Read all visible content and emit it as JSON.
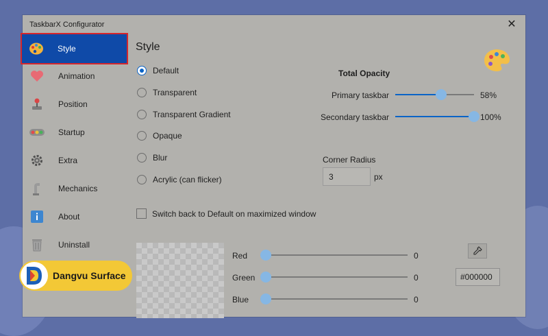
{
  "window": {
    "title": "TaskbarX Configurator",
    "close_glyph": "✕"
  },
  "sidebar": {
    "items": [
      {
        "label": "Style",
        "icon": "palette-icon",
        "active": true
      },
      {
        "label": "Animation",
        "icon": "heart-icon"
      },
      {
        "label": "Position",
        "icon": "joystick-icon"
      },
      {
        "label": "Startup",
        "icon": "startup-lights-icon"
      },
      {
        "label": "Extra",
        "icon": "gear-icon"
      },
      {
        "label": "Mechanics",
        "icon": "arm-icon"
      },
      {
        "label": "About",
        "icon": "info-icon"
      },
      {
        "label": "Uninstall",
        "icon": "trash-icon"
      }
    ]
  },
  "main": {
    "title": "Style",
    "style_options": [
      {
        "label": "Default",
        "checked": true
      },
      {
        "label": "Transparent",
        "checked": false
      },
      {
        "label": "Transparent Gradient",
        "checked": false
      },
      {
        "label": "Opaque",
        "checked": false
      },
      {
        "label": "Blur",
        "checked": false
      },
      {
        "label": "Acrylic (can flicker)",
        "checked": false
      }
    ],
    "opacity": {
      "heading": "Total Opacity",
      "primary": {
        "label": "Primary taskbar",
        "value": 58,
        "display": "58%"
      },
      "secondary": {
        "label": "Secondary taskbar",
        "value": 100,
        "display": "100%"
      }
    },
    "corner_radius": {
      "label": "Corner Radius",
      "value": "3",
      "unit": "px"
    },
    "switch_back": {
      "label": "Switch back to Default on maximized window",
      "checked": false
    },
    "color": {
      "red": {
        "label": "Red",
        "value": 0,
        "display": "0"
      },
      "green": {
        "label": "Green",
        "value": 0,
        "display": "0"
      },
      "blue": {
        "label": "Blue",
        "value": 0,
        "display": "0"
      },
      "hex": "#000000",
      "picker_icon": "eyedropper-icon"
    }
  },
  "watermark": {
    "text": "Dangvu Surface"
  },
  "colors": {
    "accent": "#0a64c7",
    "active_nav": "#0f4aa8",
    "highlight_border": "#d6262b",
    "window_bg": "#b2b1ad"
  }
}
